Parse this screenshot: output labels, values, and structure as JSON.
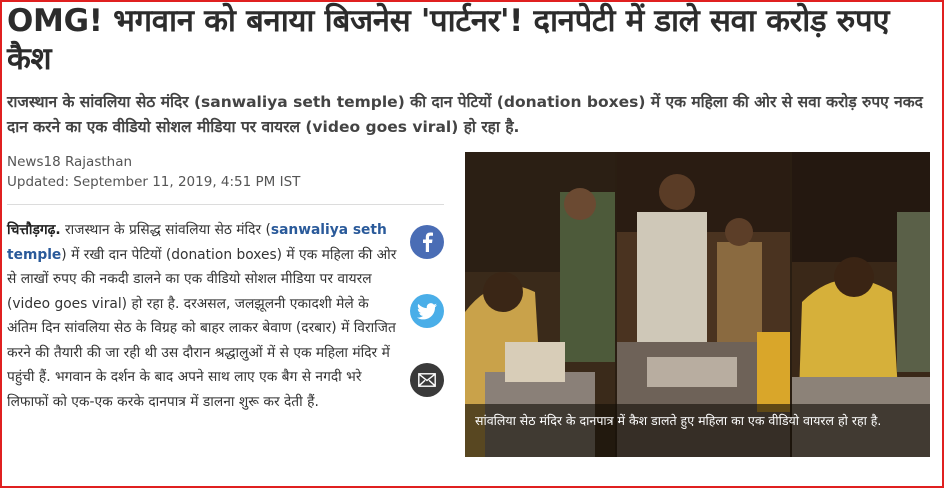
{
  "article": {
    "headline": "OMG! भगवान को बनाया बिजनेस 'पार्टनर'! दानपेटी में डाले सवा करोड़ रुपए कैश",
    "summary": "राजस्थान के सांवलिया सेठ मंदिर (sanwaliya seth temple) की दान पेटियों (donation boxes) में एक महिला की ओर से सवा करोड़ रुपए नकद दान करने का एक वीडियो सोशल मीडिया पर वायरल (video goes viral) हो रहा है.",
    "source": "News18 Rajasthan",
    "updated": "Updated: September 11, 2019, 4:51 PM IST",
    "body": {
      "dateline": "चित्तौड़गढ़.",
      "part1": " राजस्थान के प्रसिद्ध सांवलिया सेठ मंदिर  (",
      "keyword": "sanwaliya seth temple",
      "part2": ") में रखी दान पेटियों (donation boxes) में एक महिला की ओर से लाखों रुपए की नकदी डालने का एक वीडियो सोशल मीडिया पर वायरल (video goes viral) हो रहा है. दरअसल, जलझूलनी एकादशी मेले के अंतिम दिन सांवलिया सेठ के विग्रह को बाहर लाकर बेवाण (दरबार) में विराजित करने की तैयारी की जा रही थी उस दौरान श्रद्धालुओं में से एक महिला मंदिर में पहुंची हैं. भगवान के दर्शन के बाद अपने साथ लाए एक बैग से नगदी भरे लिफाफों को एक-एक करके दानपात्र में डालना शुरू कर देती हैं."
    },
    "photo_caption": "सांवलिया सेठ मंदिर के दानपात्र में कैश डालते हुए महिला का एक वीडियो वायरल हो रहा है."
  },
  "share": [
    {
      "name": "facebook",
      "icon": "facebook-icon",
      "color": "#4a6db5"
    },
    {
      "name": "twitter",
      "icon": "twitter-icon",
      "color": "#4aaee8"
    },
    {
      "name": "email",
      "icon": "mail-icon",
      "color": "#3a3a3a"
    }
  ],
  "colors": {
    "frame": "#e02020",
    "link": "#2a5a9a"
  }
}
